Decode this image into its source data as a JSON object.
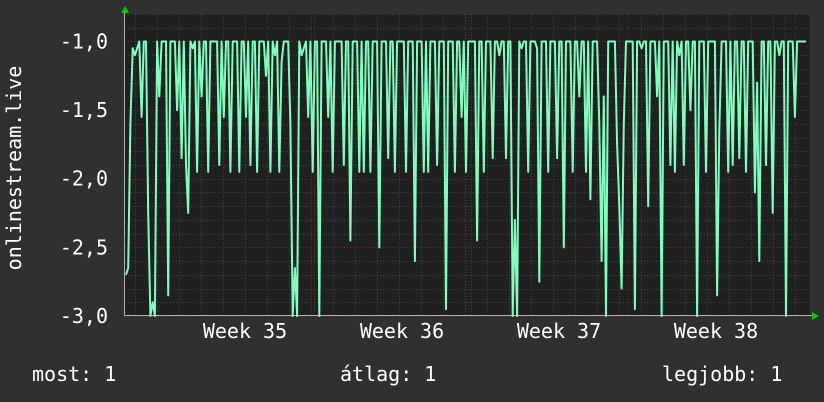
{
  "chart_data": {
    "type": "line",
    "ylabel": "onlinestream.live",
    "ylim": [
      -3.0,
      -0.8
    ],
    "y_ticks": [
      "-1,0",
      "-1,5",
      "-2,0",
      "-2,5",
      "-3,0"
    ],
    "x_ticks": [
      "Week 35",
      "Week 36",
      "Week 37",
      "Week 38"
    ],
    "grid": true,
    "colors": {
      "background": "#303030",
      "plot": "#202020",
      "line": "#7fffbf",
      "grid": "#5a3030",
      "axis_arrow": "#00cc00"
    },
    "series": [
      {
        "values": [
          -2.7,
          -2.65,
          -1.6,
          -1.05,
          -1.1,
          -1.05,
          -1.0,
          -1.55,
          -1.0,
          -1.0,
          -2.25,
          -3.0,
          -2.9,
          -3.0,
          -1.0,
          -1.4,
          -1.0,
          -1.0,
          -1.0,
          -2.85,
          -1.0,
          -1.0,
          -1.0,
          -1.5,
          -1.0,
          -1.85,
          -1.0,
          -1.9,
          -2.25,
          -1.0,
          -1.05,
          -1.0,
          -1.95,
          -1.0,
          -1.4,
          -1.0,
          -1.0,
          -1.95,
          -1.0,
          -1.0,
          -1.0,
          -1.0,
          -1.9,
          -1.0,
          -1.55,
          -1.0,
          -1.0,
          -1.95,
          -1.0,
          -1.0,
          -1.0,
          -1.95,
          -1.0,
          -1.0,
          -1.55,
          -1.0,
          -1.9,
          -1.0,
          -1.0,
          -1.95,
          -1.0,
          -1.0,
          -1.0,
          -1.25,
          -1.0,
          -1.95,
          -1.0,
          -1.1,
          -1.0,
          -1.95,
          -1.15,
          -1.0,
          -1.0,
          -1.0,
          -1.6,
          -3.0,
          -2.65,
          -3.0,
          -1.0,
          -1.1,
          -1.05,
          -1.0,
          -1.55,
          -1.0,
          -1.95,
          -1.0,
          -1.0,
          -3.0,
          -1.0,
          -1.0,
          -1.0,
          -1.55,
          -1.0,
          -1.95,
          -1.0,
          -1.0,
          -1.0,
          -1.0,
          -1.9,
          -1.0,
          -1.0,
          -2.45,
          -1.0,
          -1.0,
          -1.0,
          -1.95,
          -1.0,
          -1.95,
          -1.0,
          -1.0,
          -1.95,
          -1.0,
          -1.0,
          -1.0,
          -2.5,
          -1.0,
          -1.0,
          -1.0,
          -1.85,
          -1.0,
          -1.0,
          -1.95,
          -1.0,
          -1.0,
          -1.0,
          -1.0,
          -1.95,
          -1.0,
          -1.0,
          -1.0,
          -2.6,
          -1.0,
          -1.0,
          -1.0,
          -1.95,
          -1.0,
          -1.95,
          -1.0,
          -1.0,
          -1.0,
          -1.9,
          -1.0,
          -1.0,
          -1.0,
          -2.95,
          -1.0,
          -1.0,
          -1.0,
          -1.95,
          -1.0,
          -1.0,
          -1.55,
          -1.0,
          -1.95,
          -1.0,
          -1.0,
          -1.0,
          -1.0,
          -2.45,
          -1.0,
          -1.0,
          -1.95,
          -1.0,
          -1.0,
          -1.0,
          -1.85,
          -1.0,
          -1.0,
          -1.1,
          -1.0,
          -1.0,
          -1.85,
          -1.0,
          -1.0,
          -3.0,
          -2.3,
          -3.0,
          -1.0,
          -1.05,
          -1.0,
          -1.0,
          -1.95,
          -1.0,
          -1.0,
          -1.0,
          -1.05,
          -2.75,
          -1.0,
          -1.0,
          -1.0,
          -1.95,
          -1.0,
          -1.0,
          -1.0,
          -1.85,
          -1.0,
          -1.0,
          -2.5,
          -1.0,
          -1.0,
          -1.0,
          -1.95,
          -1.0,
          -1.0,
          -1.4,
          -1.0,
          -1.0,
          -1.95,
          -1.0,
          -2.15,
          -1.0,
          -1.0,
          -1.0,
          -1.6,
          -2.6,
          -1.4,
          -3.0,
          -1.0,
          -1.0,
          -1.0,
          -1.0,
          -1.75,
          -2.2,
          -2.8,
          -1.6,
          -1.0,
          -1.0,
          -1.0,
          -1.0,
          -2.95,
          -1.0,
          -1.0,
          -1.05,
          -1.0,
          -1.0,
          -2.2,
          -1.0,
          -1.0,
          -1.0,
          -1.4,
          -1.0,
          -3.0,
          -1.0,
          -1.0,
          -1.0,
          -1.9,
          -1.0,
          -1.95,
          -1.0,
          -1.1,
          -1.0,
          -1.9,
          -1.0,
          -1.0,
          -1.5,
          -1.0,
          -1.0,
          -3.0,
          -1.0,
          -1.0,
          -1.0,
          -1.95,
          -1.0,
          -1.0,
          -1.0,
          -1.0,
          -2.85,
          -1.65,
          -1.0,
          -1.0,
          -1.0,
          -1.95,
          -1.0,
          -1.9,
          -1.0,
          -1.0,
          -1.85,
          -1.0,
          -1.0,
          -1.95,
          -1.0,
          -1.0,
          -1.0,
          -2.1,
          -1.3,
          -2.6,
          -1.0,
          -1.0,
          -1.9,
          -1.0,
          -1.0,
          -2.25,
          -1.0,
          -1.0,
          -1.1,
          -1.0,
          -1.0,
          -3.0,
          -1.0,
          -1.0,
          -1.0,
          -1.55,
          -1.0,
          -1.0,
          -1.0,
          -1.0,
          -1.0
        ]
      }
    ]
  },
  "legend": {
    "current": "most: 1",
    "average": "átlag: 1",
    "max": "legjobb: 1"
  }
}
